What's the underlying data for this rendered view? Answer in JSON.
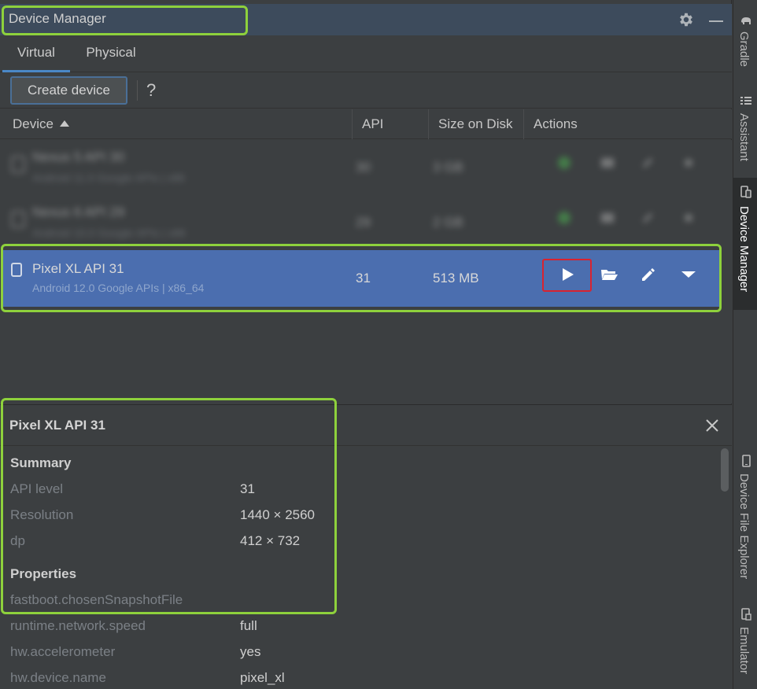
{
  "window": {
    "title": "Device Manager"
  },
  "tabs": [
    {
      "label": "Virtual",
      "active": true
    },
    {
      "label": "Physical",
      "active": false
    }
  ],
  "toolbar": {
    "create_label": "Create device",
    "help_label": "?"
  },
  "table": {
    "columns": [
      "Device",
      "API",
      "Size on Disk",
      "Actions"
    ],
    "sort_column": "Device",
    "rows": [
      {
        "name": "Nexus 5 API 30",
        "subtitle": "Android 11.0 Google APIs | x86",
        "api": "30",
        "size": "3 GB",
        "blurred": true
      },
      {
        "name": "Nexus 6 API 29",
        "subtitle": "Android 10.0 Google APIs | x86",
        "api": "29",
        "size": "2 GB",
        "blurred": true
      },
      {
        "name": "Pixel XL API 31",
        "subtitle": "Android 12.0 Google APIs | x86_64",
        "api": "31",
        "size": "513 MB",
        "blurred": false,
        "selected": true
      }
    ],
    "actions": [
      "play-icon",
      "folder-icon",
      "edit-icon",
      "dropdown-icon"
    ]
  },
  "details": {
    "title": "Pixel XL API 31",
    "summary_heading": "Summary",
    "summary": [
      {
        "key": "API level",
        "value": "31"
      },
      {
        "key": "Resolution",
        "value": "1440 × 2560"
      },
      {
        "key": "dp",
        "value": "412 × 732"
      }
    ],
    "properties_heading": "Properties",
    "properties": [
      {
        "key": "fastboot.chosenSnapshotFile",
        "value": ""
      },
      {
        "key": "runtime.network.speed",
        "value": "full"
      },
      {
        "key": "hw.accelerometer",
        "value": "yes"
      },
      {
        "key": "hw.device.name",
        "value": "pixel_xl"
      }
    ]
  },
  "sidebar": {
    "items": [
      {
        "label": "Gradle",
        "icon": "elephant-icon"
      },
      {
        "label": "Assistant",
        "icon": "list-icon"
      },
      {
        "label": "Device Manager",
        "icon": "devices-icon",
        "active": true
      },
      {
        "label": "Device File Explorer",
        "icon": "phone-icon"
      },
      {
        "label": "Emulator",
        "icon": "emulator-icon"
      }
    ]
  },
  "colors": {
    "selection": "#4b6eaf",
    "highlight_green": "#8ed13c",
    "highlight_red": "#d9232f",
    "accent": "#4a88c7"
  }
}
